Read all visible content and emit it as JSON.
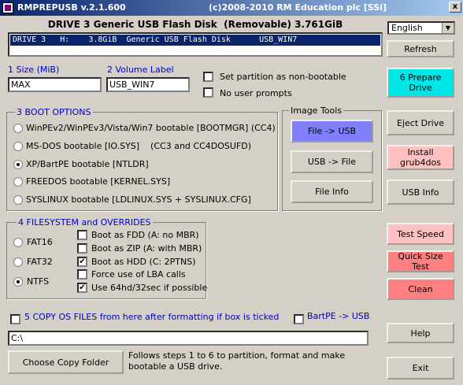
{
  "window": {
    "title_left": "RMPREPUSB v.2.1.600",
    "title_right": "(c)2008-2010 RM Education plc [SSi]",
    "close_glyph": "x"
  },
  "drive": {
    "header": "DRIVE 3 Generic USB Flash Disk  (Removable) 3.761GiB",
    "row": "DRIVE 3   H:    3.8GiB  Generic USB Flash Disk      USB_WIN7"
  },
  "language": {
    "selected": "English"
  },
  "size": {
    "label": "1 Size (MiB)",
    "value": "MAX"
  },
  "volume": {
    "label": "2 Volume Label",
    "value": "USB_WIN7"
  },
  "options": {
    "nonbootable": "Set partition as non-bootable",
    "no_prompts": "No user prompts"
  },
  "boot": {
    "title": "3 BOOT OPTIONS",
    "items": [
      {
        "label": "WinPEv2/WinPEv3/Vista/Win7 bootable [BOOTMGR] (CC4)",
        "selected": false
      },
      {
        "label": "MS-DOS bootable [IO.SYS]    (CC3 and CC4DOSUFD)",
        "selected": false
      },
      {
        "label": "XP/BartPE bootable [NTLDR]",
        "selected": true
      },
      {
        "label": "FREEDOS bootable [KERNEL.SYS]",
        "selected": false
      },
      {
        "label": "SYSLINUX bootable [LDLINUX.SYS + SYSLINUX.CFG]",
        "selected": false
      }
    ]
  },
  "image_tools": {
    "title": "Image Tools",
    "file_to_usb": "File -> USB",
    "usb_to_file": "USB -> File",
    "file_info": "File Info"
  },
  "fs": {
    "title": "4 FILESYSTEM and OVERRIDES",
    "fat16": "FAT16",
    "fat32": "FAT32",
    "ntfs": "NTFS",
    "checks": [
      {
        "label": "Boot as FDD (A: no MBR)",
        "checked": false
      },
      {
        "label": "Boot as ZIP (A: with MBR)",
        "checked": false
      },
      {
        "label": "Boot as HDD (C: 2PTNS)",
        "checked": true
      },
      {
        "label": "Force use of LBA calls",
        "checked": false
      },
      {
        "label": "Use 64hd/32sec if possible",
        "checked": true
      }
    ]
  },
  "copy": {
    "label": "5 COPY OS FILES from here after formatting if box is ticked",
    "bartpe": "BartPE -> USB",
    "path": "C:\\",
    "choose": "Choose Copy Folder",
    "note": "Follows steps 1 to 6 to partition, format and make bootable a USB drive."
  },
  "right": {
    "refresh": "Refresh",
    "prepare": "6 Prepare Drive",
    "eject": "Eject Drive",
    "grub": "Install grub4dos",
    "usbinfo": "USB Info",
    "testspeed": "Test Speed",
    "quicktest": "Quick Size Test",
    "clean": "Clean",
    "help": "Help",
    "exit": "Exit"
  },
  "colors": {
    "prepare_bg": "#00e5e5",
    "file_to_usb_bg": "#8080ff",
    "test_speed_bg": "#ffc0c0",
    "quick_test_bg": "#ff8080",
    "label_blue": "#0000c0"
  },
  "check_glyph": "✔"
}
